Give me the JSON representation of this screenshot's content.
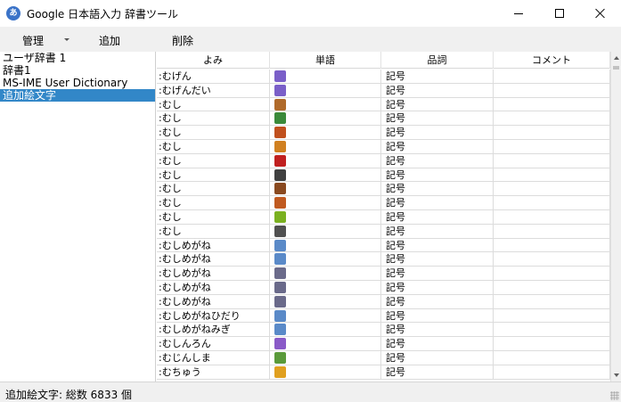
{
  "window": {
    "title": "Google 日本語入力 辞書ツール",
    "icon_name": "google-ime-icon"
  },
  "menu": {
    "manage": "管理",
    "add": "追加",
    "delete": "削除"
  },
  "dictionaries": [
    {
      "label": "ユーザ辞書 1",
      "selected": false
    },
    {
      "label": "辞書1",
      "selected": false
    },
    {
      "label": "MS-IME User Dictionary",
      "selected": false
    },
    {
      "label": "追加絵文字",
      "selected": true
    }
  ],
  "table": {
    "headers": [
      "よみ",
      "単語",
      "品詞",
      "コメント"
    ],
    "rows": [
      {
        "yomi": ":むげん",
        "word_icon": "infinity-icon",
        "color": "#7a5fc8",
        "pos": "記号",
        "comment": ""
      },
      {
        "yomi": ":むげんだい",
        "word_icon": "infinity-icon",
        "color": "#7a5fc8",
        "pos": "記号",
        "comment": ""
      },
      {
        "yomi": ":むし",
        "word_icon": "snail-icon",
        "color": "#b06a2a",
        "pos": "記号",
        "comment": ""
      },
      {
        "yomi": ":むし",
        "word_icon": "bug-icon",
        "color": "#3a8a3a",
        "pos": "記号",
        "comment": ""
      },
      {
        "yomi": ":むし",
        "word_icon": "worm-icon",
        "color": "#c0501e",
        "pos": "記号",
        "comment": ""
      },
      {
        "yomi": ":むし",
        "word_icon": "ant-icon",
        "color": "#d08020",
        "pos": "記号",
        "comment": ""
      },
      {
        "yomi": ":むし",
        "word_icon": "lady-beetle-icon",
        "color": "#c02020",
        "pos": "記号",
        "comment": ""
      },
      {
        "yomi": ":むし",
        "word_icon": "beetle-icon",
        "color": "#404040",
        "pos": "記号",
        "comment": ""
      },
      {
        "yomi": ":むし",
        "word_icon": "cockroach-icon",
        "color": "#8a4a20",
        "pos": "記号",
        "comment": ""
      },
      {
        "yomi": ":むし",
        "word_icon": "butterfly-icon",
        "color": "#c05a20",
        "pos": "記号",
        "comment": ""
      },
      {
        "yomi": ":むし",
        "word_icon": "caterpillar-icon",
        "color": "#7ab020",
        "pos": "記号",
        "comment": ""
      },
      {
        "yomi": ":むし",
        "word_icon": "mosquito-icon",
        "color": "#505050",
        "pos": "記号",
        "comment": ""
      },
      {
        "yomi": ":むしめがね",
        "word_icon": "magnifier-left-icon",
        "color": "#5a8ac8",
        "pos": "記号",
        "comment": ""
      },
      {
        "yomi": ":むしめがね",
        "word_icon": "magnifier-right-icon",
        "color": "#5a8ac8",
        "pos": "記号",
        "comment": ""
      },
      {
        "yomi": ":むしめがね",
        "word_icon": "detective-icon",
        "color": "#6a6a8a",
        "pos": "記号",
        "comment": ""
      },
      {
        "yomi": ":むしめがね",
        "word_icon": "detective-woman-icon",
        "color": "#6a6a8a",
        "pos": "記号",
        "comment": ""
      },
      {
        "yomi": ":むしめがね",
        "word_icon": "detective-man-icon",
        "color": "#6a6a8a",
        "pos": "記号",
        "comment": ""
      },
      {
        "yomi": ":むしめがねひだり",
        "word_icon": "magnifier-left-icon",
        "color": "#5a8ac8",
        "pos": "記号",
        "comment": ""
      },
      {
        "yomi": ":むしめがねみぎ",
        "word_icon": "magnifier-right-icon",
        "color": "#5a8ac8",
        "pos": "記号",
        "comment": ""
      },
      {
        "yomi": ":むしんろん",
        "word_icon": "atom-icon",
        "color": "#8a5ac8",
        "pos": "記号",
        "comment": ""
      },
      {
        "yomi": ":むじんしま",
        "word_icon": "island-icon",
        "color": "#5a9a3a",
        "pos": "記号",
        "comment": ""
      },
      {
        "yomi": ":むちゅう",
        "word_icon": "face-icon",
        "color": "#e0a020",
        "pos": "記号",
        "comment": ""
      }
    ]
  },
  "status": "追加絵文字: 総数 6833 個"
}
